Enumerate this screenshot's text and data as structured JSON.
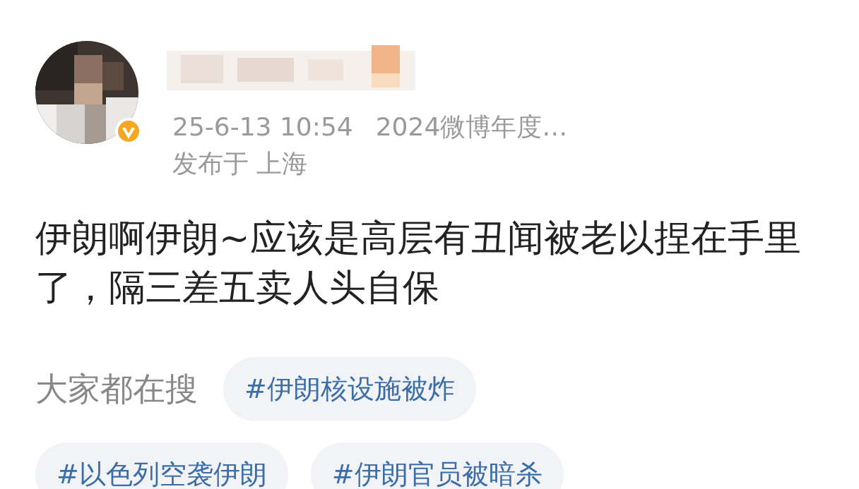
{
  "author": {
    "verified": true
  },
  "post": {
    "time": "25-6-13 10:54",
    "source": "2024微博年度…",
    "location": "发布于 上海",
    "text": "伊朗啊伊朗~应该是高层有丑闻被老以捏在手里了，隔三差五卖人头自保"
  },
  "trending": {
    "label": "大家都在搜",
    "tags": [
      "#伊朗核设施被炸",
      "#以色列空袭伊朗",
      "#伊朗官员被暗杀"
    ]
  }
}
